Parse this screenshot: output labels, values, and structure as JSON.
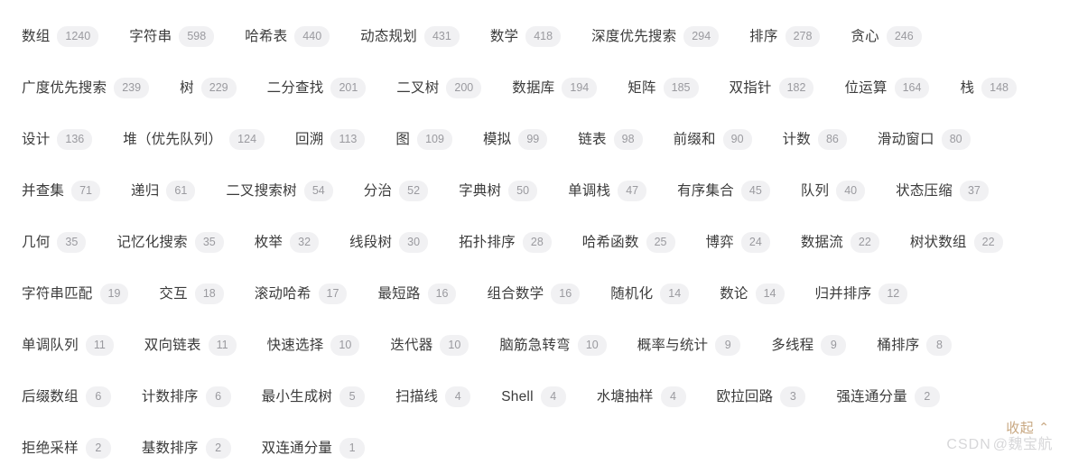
{
  "panel": {
    "name": "topic-tag-cloud"
  },
  "rows": [
    [
      {
        "label": "数组",
        "count": "1240"
      },
      {
        "label": "字符串",
        "count": "598"
      },
      {
        "label": "哈希表",
        "count": "440"
      },
      {
        "label": "动态规划",
        "count": "431"
      },
      {
        "label": "数学",
        "count": "418"
      },
      {
        "label": "深度优先搜索",
        "count": "294"
      },
      {
        "label": "排序",
        "count": "278"
      },
      {
        "label": "贪心",
        "count": "246"
      }
    ],
    [
      {
        "label": "广度优先搜索",
        "count": "239"
      },
      {
        "label": "树",
        "count": "229"
      },
      {
        "label": "二分查找",
        "count": "201"
      },
      {
        "label": "二叉树",
        "count": "200"
      },
      {
        "label": "数据库",
        "count": "194"
      },
      {
        "label": "矩阵",
        "count": "185"
      },
      {
        "label": "双指针",
        "count": "182"
      },
      {
        "label": "位运算",
        "count": "164"
      },
      {
        "label": "栈",
        "count": "148"
      }
    ],
    [
      {
        "label": "设计",
        "count": "136"
      },
      {
        "label": "堆（优先队列）",
        "count": "124"
      },
      {
        "label": "回溯",
        "count": "113"
      },
      {
        "label": "图",
        "count": "109"
      },
      {
        "label": "模拟",
        "count": "99"
      },
      {
        "label": "链表",
        "count": "98"
      },
      {
        "label": "前缀和",
        "count": "90"
      },
      {
        "label": "计数",
        "count": "86"
      },
      {
        "label": "滑动窗口",
        "count": "80"
      }
    ],
    [
      {
        "label": "并查集",
        "count": "71"
      },
      {
        "label": "递归",
        "count": "61"
      },
      {
        "label": "二叉搜索树",
        "count": "54"
      },
      {
        "label": "分治",
        "count": "52"
      },
      {
        "label": "字典树",
        "count": "50"
      },
      {
        "label": "单调栈",
        "count": "47"
      },
      {
        "label": "有序集合",
        "count": "45"
      },
      {
        "label": "队列",
        "count": "40"
      },
      {
        "label": "状态压缩",
        "count": "37"
      }
    ],
    [
      {
        "label": "几何",
        "count": "35"
      },
      {
        "label": "记忆化搜索",
        "count": "35"
      },
      {
        "label": "枚举",
        "count": "32"
      },
      {
        "label": "线段树",
        "count": "30"
      },
      {
        "label": "拓扑排序",
        "count": "28"
      },
      {
        "label": "哈希函数",
        "count": "25"
      },
      {
        "label": "博弈",
        "count": "24"
      },
      {
        "label": "数据流",
        "count": "22"
      },
      {
        "label": "树状数组",
        "count": "22"
      }
    ],
    [
      {
        "label": "字符串匹配",
        "count": "19"
      },
      {
        "label": "交互",
        "count": "18"
      },
      {
        "label": "滚动哈希",
        "count": "17"
      },
      {
        "label": "最短路",
        "count": "16"
      },
      {
        "label": "组合数学",
        "count": "16"
      },
      {
        "label": "随机化",
        "count": "14"
      },
      {
        "label": "数论",
        "count": "14"
      },
      {
        "label": "归并排序",
        "count": "12"
      }
    ],
    [
      {
        "label": "单调队列",
        "count": "11"
      },
      {
        "label": "双向链表",
        "count": "11"
      },
      {
        "label": "快速选择",
        "count": "10"
      },
      {
        "label": "迭代器",
        "count": "10"
      },
      {
        "label": "脑筋急转弯",
        "count": "10"
      },
      {
        "label": "概率与统计",
        "count": "9"
      },
      {
        "label": "多线程",
        "count": "9"
      },
      {
        "label": "桶排序",
        "count": "8"
      }
    ],
    [
      {
        "label": "后缀数组",
        "count": "6"
      },
      {
        "label": "计数排序",
        "count": "6"
      },
      {
        "label": "最小生成树",
        "count": "5"
      },
      {
        "label": "扫描线",
        "count": "4"
      },
      {
        "label": "Shell",
        "count": "4"
      },
      {
        "label": "水塘抽样",
        "count": "4"
      },
      {
        "label": "欧拉回路",
        "count": "3"
      },
      {
        "label": "强连通分量",
        "count": "2"
      }
    ],
    [
      {
        "label": "拒绝采样",
        "count": "2"
      },
      {
        "label": "基数排序",
        "count": "2"
      },
      {
        "label": "双连通分量",
        "count": "1"
      }
    ]
  ],
  "collapse": {
    "label": "收起",
    "caret": "⌃"
  },
  "watermark": {
    "brand": "CSDN",
    "user": "@魏宝航"
  },
  "colors": {
    "tag_text": "#3b3b3b",
    "count_bg": "#f1f1f3",
    "count_text": "#9a9a9f",
    "collapse": "#c8a882",
    "watermark": "#d7d7d9",
    "background": "#ffffff"
  }
}
